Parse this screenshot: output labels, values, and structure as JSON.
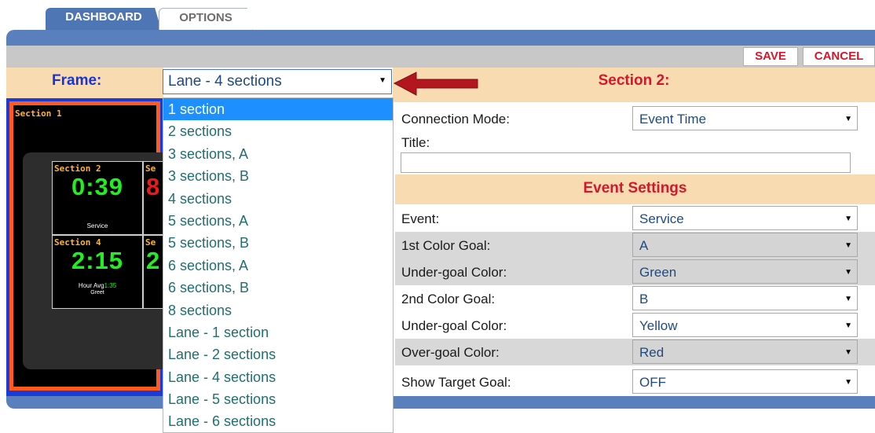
{
  "tabs": {
    "dashboard": "DASHBOARD",
    "options": "OPTIONS"
  },
  "toolbar": {
    "save": "SAVE",
    "cancel": "CANCEL"
  },
  "frame": {
    "label": "Frame:",
    "selected": "Lane - 4 sections"
  },
  "frame_options": [
    "1 section",
    "2 sections",
    "3 sections, A",
    "3 sections, B",
    "4 sections",
    "5 sections, A",
    "5 sections, B",
    "6 sections, A",
    "6 sections, B",
    "8 sections",
    "Lane - 1 section",
    "Lane - 2 sections",
    "Lane - 4 sections",
    "Lane - 5 sections",
    "Lane - 6 sections"
  ],
  "section_header": "Section 2:",
  "preview": {
    "section1": "Section 1",
    "cell_a": {
      "title": "Section 2",
      "time": "0:39",
      "sub": "Service"
    },
    "cell_b": {
      "title": "Se",
      "time": "8"
    },
    "cell_c": {
      "title": "Section 4",
      "time": "2:15",
      "sub_label": "Hour Avg",
      "sub_value": "1:35",
      "sub2": "Greet"
    },
    "cell_d": {
      "title": "Se",
      "time": "2"
    }
  },
  "settings": {
    "connection_mode": {
      "label": "Connection Mode:",
      "value": "Event Time"
    },
    "title_label": "Title:",
    "event_settings": "Event Settings",
    "rows": [
      {
        "label": "Event:",
        "value": "Service"
      },
      {
        "label": "1st Color Goal:",
        "value": "A"
      },
      {
        "label": "Under-goal Color:",
        "value": "Green"
      },
      {
        "label": "2nd Color Goal:",
        "value": "B"
      },
      {
        "label": "Under-goal Color:",
        "value": "Yellow"
      },
      {
        "label": "Over-goal Color:",
        "value": "Red"
      },
      {
        "label": "Show Target Goal:",
        "value": "OFF"
      }
    ]
  },
  "colors": {
    "accent": "#5a7fbd",
    "header_beige": "#f9dbb2",
    "alert_red": "#d4172b",
    "selected_blue": "#1e8fff"
  }
}
